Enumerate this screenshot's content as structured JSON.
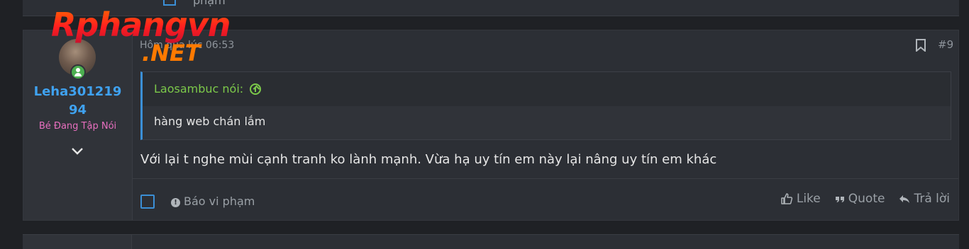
{
  "prev_post": {
    "remnant_text": "phạm"
  },
  "logo": {
    "main": "Rphangvn",
    "sub": ".NET"
  },
  "post": {
    "user": {
      "name": "Leha30121994",
      "title": "Bé Đang Tập Nói"
    },
    "time": "Hôm qua lúc 06:53",
    "number": "#9",
    "quote": {
      "author": "Laosambuc nói:",
      "text": "hàng web chán lắm"
    },
    "message": "Với lại t nghe mùi cạnh tranh ko lành mạnh. Vừa hạ uy tín em này lại nâng uy tín em khác",
    "footer": {
      "report": "Báo vi phạm",
      "like": "Like",
      "quote": "Quote",
      "reply": "Trả lời"
    }
  },
  "colors": {
    "username": "#3fa2f0",
    "user_title": "#e86fbf",
    "quote_author": "#7cc94a",
    "accent": "#3b8fd6"
  },
  "icons": [
    "online-status-icon",
    "chevron-down-icon",
    "bookmark-icon",
    "arrow-up-circle-icon",
    "alert-icon",
    "thumbs-up-icon",
    "quote-icon",
    "reply-icon"
  ]
}
